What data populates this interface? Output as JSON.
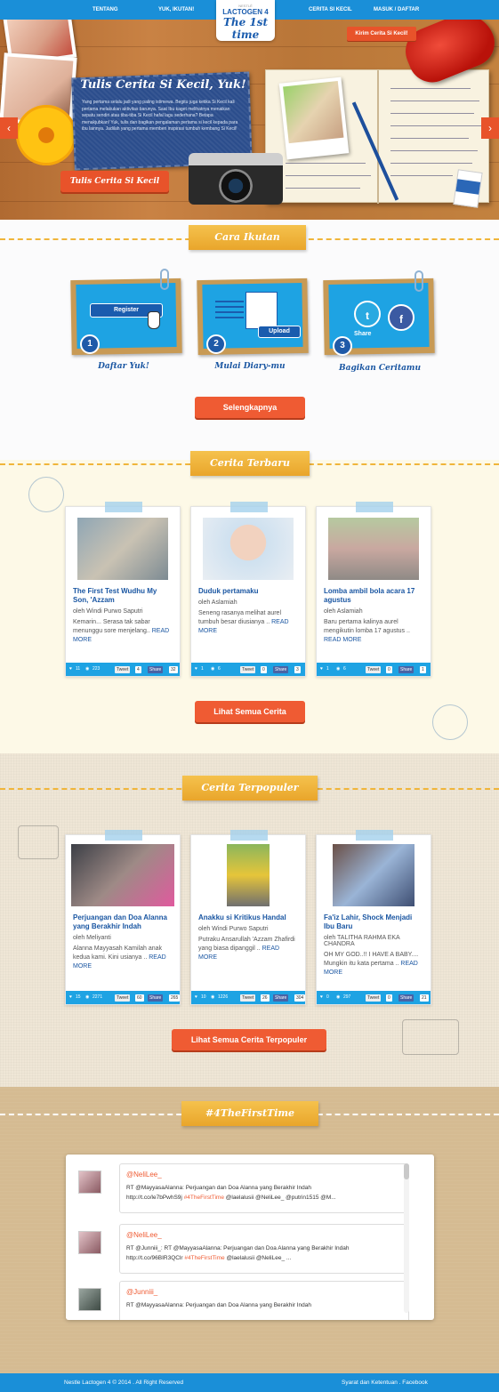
{
  "nav": {
    "items": [
      "TENTANG",
      "YUK, IKUTAN!",
      "CERITA SI KECIL",
      "MASUK / DAFTAR"
    ],
    "logo": {
      "brand_small": "NESTLÉ",
      "brand": "LACTOGEN 4",
      "tagline": "The 1st time"
    }
  },
  "hero": {
    "title": "Tulis Cerita Si Kecil, Yuk!",
    "text": "Yang pertama selalu jadi yang paling istimewa. Begitu juga ketika Si Kecil kali pertama melakukan aktivitas barunya. Saat Ibu kaget melihatnya menaikan sepatu sendiri atau tiba-tiba Si Kecil hafal lagu sederhana? Betapa menakjubkan! Yuk, tulis dan bagikan pengalaman pertama si kecil kepada para ibu lainnya. Jadilah yang pertama memberi inspirasi tumbuh kembang Si Kecil!",
    "cta": "Tulis Cerita Si Kecil",
    "kirim": "Kirim Cerita Si Kecil!",
    "arrow_left": "‹",
    "arrow_right": "›"
  },
  "cara": {
    "banner": "Cara Ikutan",
    "steps": [
      {
        "num": "1",
        "label": "Daftar Yuk!",
        "button": "Register"
      },
      {
        "num": "2",
        "label": "Mulai Diary-mu",
        "button": "Upload"
      },
      {
        "num": "3",
        "label": "Bagikan Ceritamu",
        "button": "Share"
      }
    ],
    "more_button": "Selengkapnya",
    "social": {
      "twitter": "t",
      "facebook": "f"
    }
  },
  "terbaru": {
    "banner": "Cerita Terbaru",
    "see_all": "Lihat Semua Cerita",
    "cards": [
      {
        "title": "The First Test Wudhu My Son, 'Azzam",
        "author": "oleh Windi Purwo Saputri",
        "excerpt": "Kemarin... Serasa tak sabar menunggu sore menjelang..",
        "more": "READ MORE",
        "likes": "11",
        "views": "223",
        "tweets": "4",
        "shares": "32"
      },
      {
        "title": "Duduk pertamaku",
        "author": "oleh Aslamiah",
        "excerpt": "Seneng rasanya melihat aurel tumbuh besar diusianya ..",
        "more": "READ MORE",
        "likes": "1",
        "views": "6",
        "tweets": "0",
        "shares": "3"
      },
      {
        "title": "Lomba ambil bola acara 17 agustus",
        "author": "oleh Aslamiah",
        "excerpt": "Baru pertama kalinya aurel mengikutin lomba 17 agustus ..",
        "more": "READ MORE",
        "likes": "1",
        "views": "6",
        "tweets": "0",
        "shares": "1"
      }
    ]
  },
  "populer": {
    "banner": "Cerita Terpopuler",
    "see_all": "Lihat Semua Cerita Terpopuler",
    "cards": [
      {
        "title": "Perjuangan dan Doa Alanna yang Berakhir Indah",
        "author": "oleh Meliyanti",
        "excerpt": "Alanna Mayyasah Kamilah anak kedua kami. Kini usianya ..",
        "more": "READ MORE",
        "likes": "15",
        "views": "2271",
        "tweets": "60",
        "shares": "265"
      },
      {
        "title": "Anakku si Kritikus Handal",
        "author": "oleh Windi Purwo Saputri",
        "excerpt": "Putraku Ansarullah 'Azzam Zhafirdi yang biasa dipanggil ..",
        "more": "READ MORE",
        "likes": "10",
        "views": "1226",
        "tweets": "26",
        "shares": "304"
      },
      {
        "title": "Fa'iz Lahir, Shock Menjadi Ibu Baru",
        "author": "oleh TALITHA RAHMA EKA CHANDRA",
        "excerpt": "OH MY GOD..!! I HAVE A BABY.... Mungkin itu kata pertama ..",
        "more": "READ MORE",
        "likes": "0",
        "views": "297",
        "tweets": "0",
        "shares": "21"
      }
    ]
  },
  "hashtag": {
    "banner": "#4TheFirstTime",
    "tweets": [
      {
        "user": "@NeliLee_",
        "line1": "RT @MayyasaAlanna: Perjuangan dan Doa Alanna yang Berakhir Indah",
        "line2_pre": "http://t.co/le7bPwhS9j ",
        "tag": "#4TheFirstTime",
        "line2_post": " @laelalusii @NeliLee_ @putrin1515 @M..."
      },
      {
        "user": "@NeliLee_",
        "line1": "RT @Junniii_: RT @MayyasaAlanna: Perjuangan dan Doa Alanna yang Berakhir Indah",
        "line2_pre": "http://t.co/96BIR3QClr ",
        "tag": "#4TheFirstTime",
        "line2_post": " @laelalusii @NeliLee_ ..."
      },
      {
        "user": "@Junniii_",
        "line1": "RT @MayyasaAlanna: Perjuangan dan Doa Alanna yang Berakhir Indah",
        "line2_pre": "",
        "tag": "",
        "line2_post": ""
      }
    ]
  },
  "footer": {
    "copyright": "Nestle Lactogen 4 © 2014 . All Right Reserved",
    "links": "Syarat dan Ketentuan . Facebook"
  },
  "colors": {
    "nav_blue": "#1a8fd8",
    "accent_orange": "#ef5b33",
    "banner_yellow": "#f5c24d",
    "link_blue": "#1a56a2",
    "card_footer_blue": "#1ea3e3"
  },
  "icons": [
    "heart-icon",
    "eye-icon",
    "twitter-icon",
    "facebook-icon",
    "paperclip-icon",
    "hand-cursor-icon",
    "document-icon"
  ]
}
